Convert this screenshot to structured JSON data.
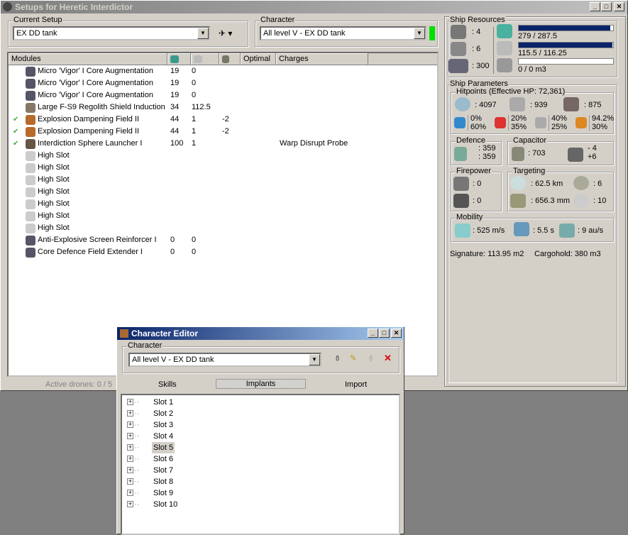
{
  "main": {
    "title": "Setups for Heretic Interdictor",
    "current_setup": {
      "label": "Current Setup",
      "value": "EX DD tank"
    },
    "character": {
      "label": "Character",
      "value": "All level V - EX DD tank",
      "status_color": "#00e000"
    },
    "columns": [
      "Modules",
      "",
      "",
      "",
      "Optimal",
      "Charges"
    ],
    "modules": [
      {
        "name": "Micro 'Vigor' I Core Augmentation",
        "cpu": "19",
        "pg": "0",
        "cap": "",
        "charge": "",
        "active": false,
        "icon": "rig-icon"
      },
      {
        "name": "Micro 'Vigor' I Core Augmentation",
        "cpu": "19",
        "pg": "0",
        "cap": "",
        "charge": "",
        "active": false,
        "icon": "rig-icon"
      },
      {
        "name": "Micro 'Vigor' I Core Augmentation",
        "cpu": "19",
        "pg": "0",
        "cap": "",
        "charge": "",
        "active": false,
        "icon": "rig-icon"
      },
      {
        "name": "Large F-S9 Regolith Shield Induction",
        "cpu": "34",
        "pg": "112.5",
        "cap": "",
        "charge": "",
        "active": false,
        "icon": "shield-extender-icon"
      },
      {
        "name": "Explosion Dampening Field II",
        "cpu": "44",
        "pg": "1",
        "cap": "-2",
        "charge": "",
        "active": true,
        "icon": "hardener-icon"
      },
      {
        "name": "Explosion Dampening Field II",
        "cpu": "44",
        "pg": "1",
        "cap": "-2",
        "charge": "",
        "active": true,
        "icon": "hardener-icon"
      },
      {
        "name": "Interdiction Sphere Launcher I",
        "cpu": "100",
        "pg": "1",
        "cap": "",
        "charge": "Warp Disrupt Probe",
        "active": true,
        "icon": "launcher-icon"
      },
      {
        "name": "High Slot",
        "cpu": "",
        "pg": "",
        "cap": "",
        "charge": "",
        "active": false,
        "icon": "empty-slot-icon"
      },
      {
        "name": "High Slot",
        "cpu": "",
        "pg": "",
        "cap": "",
        "charge": "",
        "active": false,
        "icon": "empty-slot-icon"
      },
      {
        "name": "High Slot",
        "cpu": "",
        "pg": "",
        "cap": "",
        "charge": "",
        "active": false,
        "icon": "empty-slot-icon"
      },
      {
        "name": "High Slot",
        "cpu": "",
        "pg": "",
        "cap": "",
        "charge": "",
        "active": false,
        "icon": "empty-slot-icon"
      },
      {
        "name": "High Slot",
        "cpu": "",
        "pg": "",
        "cap": "",
        "charge": "",
        "active": false,
        "icon": "empty-slot-icon"
      },
      {
        "name": "High Slot",
        "cpu": "",
        "pg": "",
        "cap": "",
        "charge": "",
        "active": false,
        "icon": "empty-slot-icon"
      },
      {
        "name": "High Slot",
        "cpu": "",
        "pg": "",
        "cap": "",
        "charge": "",
        "active": false,
        "icon": "empty-slot-icon"
      },
      {
        "name": "Anti-Explosive Screen Reinforcer I",
        "cpu": "0",
        "pg": "0",
        "cap": "",
        "charge": "",
        "active": false,
        "icon": "rig-icon"
      },
      {
        "name": "Core Defence Field Extender I",
        "cpu": "0",
        "pg": "0",
        "cap": "",
        "charge": "",
        "active": false,
        "icon": "rig-icon"
      }
    ],
    "active_drones": "Active drones: 0 / 5"
  },
  "resources": {
    "label": "Ship Resources",
    "turrets": ": 4",
    "launchers": ": 6",
    "calibration": ": 300",
    "cpu": "279 / 287.5",
    "cpu_fraction": 0.97,
    "pg": "115.5 / 116.25",
    "pg_fraction": 0.994,
    "drone": "0 / 0 m3",
    "drone_fraction": 0
  },
  "params": {
    "label": "Ship Parameters",
    "hitpoints_label": "Hitpoints (Effective HP: 72,361)",
    "shield": ": 4097",
    "armor": ": 939",
    "structure": ": 875",
    "resists": [
      {
        "a": "0%",
        "b": "60%"
      },
      {
        "a": "20%",
        "b": "35%"
      },
      {
        "a": "40%",
        "b": "25%"
      },
      {
        "a": "94.2%",
        "b": "30%"
      }
    ],
    "defence_label": "Defence",
    "def_a": ": 359",
    "def_b": ": 359",
    "capacitor_label": "Capacitor",
    "cap": ": 703",
    "cap_a": "- 4",
    "cap_b": "+6",
    "firepower_label": "Firepower",
    "fp_a": ": 0",
    "fp_b": ": 0",
    "targeting_label": "Targeting",
    "range": ": 62.5 km",
    "targets": ": 6",
    "scan": ": 656.3 mm",
    "sensor": ": 10",
    "mobility_label": "Mobility",
    "speed": ": 525 m/s",
    "align": ": 5.5 s",
    "warp": ": 9 au/s",
    "signature": "Signature: 113.95 m2",
    "cargo": "Cargohold: 380 m3"
  },
  "editor": {
    "title": "Character Editor",
    "char_label": "Character",
    "char_value": "All level V - EX DD tank",
    "tabs": [
      "Skills",
      "Implants",
      "Import"
    ],
    "slots": [
      "Slot 1",
      "Slot 2",
      "Slot 3",
      "Slot 4",
      "Slot 5",
      "Slot 6",
      "Slot 7",
      "Slot 8",
      "Slot 9",
      "Slot 10"
    ],
    "selected_slot": 4
  }
}
